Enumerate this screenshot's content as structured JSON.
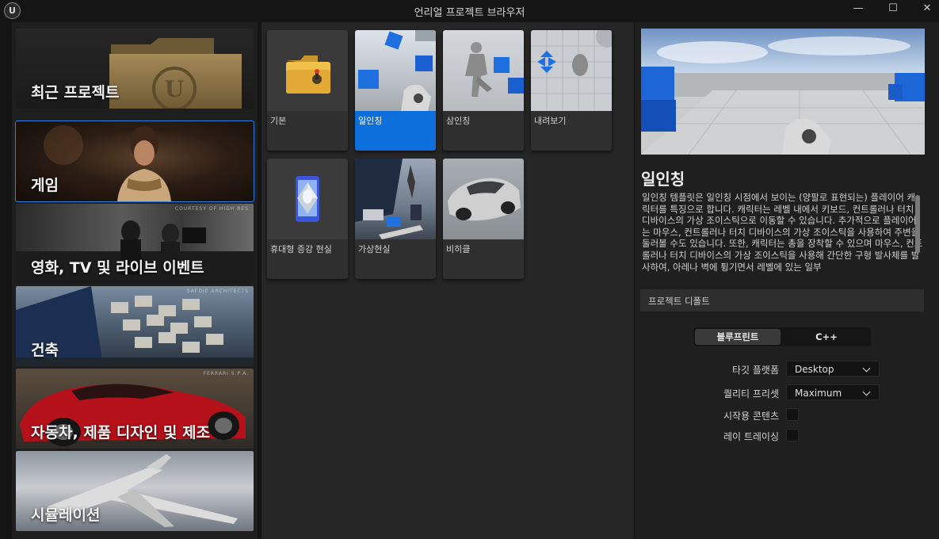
{
  "window": {
    "title": "언리얼 프로젝트 브라우저",
    "logo_text": "U",
    "minimize_glyph": "—",
    "maximize_glyph": "☐",
    "close_glyph": "✕"
  },
  "categories": [
    {
      "label": "최근 프로젝트",
      "credit": ""
    },
    {
      "label": "게임",
      "credit": ""
    },
    {
      "label": "영화, TV 및 라이브 이벤트",
      "credit": "COURTESY OF HIGH RES"
    },
    {
      "label": "건축",
      "credit": "SAFDIE ARCHITECTS"
    },
    {
      "label": "자동차, 제품 디자인 및 제조",
      "credit": "FERRARI S.P.A."
    },
    {
      "label": "시뮬레이션",
      "credit": ""
    }
  ],
  "selected_category": "게임",
  "templates": [
    {
      "label": "기본"
    },
    {
      "label": "일인칭"
    },
    {
      "label": "삼인칭"
    },
    {
      "label": "내려보기"
    },
    {
      "label": "휴대형 증강 현실"
    },
    {
      "label": "가상현실"
    },
    {
      "label": "비히클"
    }
  ],
  "selected_template": "일인칭",
  "detail": {
    "title": "일인칭",
    "description": "일인칭 템플릿은 일인칭 시점에서 보이는 (양팔로 표현되는) 플레이어 캐릭터를 특징으로 합니다. 캐릭터는 레벨 내에서 키보드, 컨트롤러나 터치 디바이스의 가상 조이스틱으로 이동할 수 있습니다. 추가적으로 플레이어는 마우스, 컨트롤러나 터치 디바이스의 가상 조이스틱을 사용하여 주변을 둘러볼 수도 있습니다. 또한, 캐릭터는 총을 장착할 수 있으며 마우스, 컨트롤러나 터치 디바이스의 가상 조이스틱을 사용해 간단한 구형 발사체를 발사하여, 아레나 벽에 튕기면서 레벨에 있는 일부"
  },
  "project_defaults": {
    "header": "프로젝트 디폴트",
    "blueprint_label": "블루프린트",
    "cpp_label": "C++",
    "active_mode": "블루프린트",
    "target_platform_label": "타깃 플랫폼",
    "target_platform_value": "Desktop",
    "quality_preset_label": "퀄리티 프리셋",
    "quality_preset_value": "Maximum",
    "starter_content_label": "시작용 콘텐츠",
    "starter_content_checked": false,
    "raytracing_label": "레이 트레이싱",
    "raytracing_checked": false
  }
}
